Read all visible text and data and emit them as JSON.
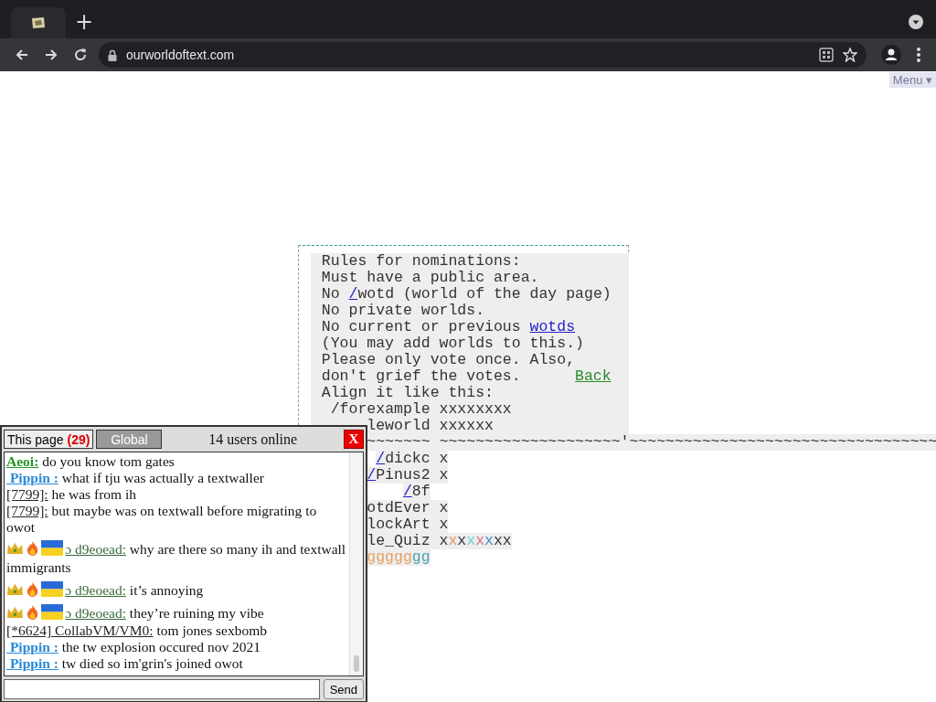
{
  "browser": {
    "new_tab": "+",
    "url": "ourworldoftext.com"
  },
  "menu": {
    "label": "Menu",
    "caret": "▾"
  },
  "world": {
    "lines": [
      [
        {
          "text": "  Rules for nominations:"
        }
      ],
      [
        {
          "text": "  Must have a public area."
        }
      ],
      [
        {
          "text": "  No "
        },
        {
          "text": "/",
          "kind": "link",
          "color": "#2020cc"
        },
        {
          "text": "wotd (world of the day page)"
        }
      ],
      [
        {
          "text": "  No private worlds."
        }
      ],
      [
        {
          "text": "  No current or previous "
        },
        {
          "text": "wotds",
          "kind": "link",
          "color": "#2020cc"
        }
      ],
      [
        {
          "text": "  (You may add worlds to this.)"
        }
      ],
      [
        {
          "text": "  Please only vote once. Also,"
        }
      ],
      [
        {
          "text": "  don't grief the votes.      "
        },
        {
          "text": "Back",
          "kind": "link",
          "color": "#2a8a2a"
        }
      ],
      [
        {
          "text": "  Align it like this:"
        }
      ],
      [
        {
          "text": "   /forexample xxxxxxxx"
        }
      ],
      [
        {
          "text": "       leworld xxxxxx"
        }
      ],
      [
        {
          "text": "       ~~~~~~~ ~~~~~~~~~~~~~~~~~~~~'~~~~~~~~~~~~~~~~~~~~~~~~~~~~~~~~~~"
        }
      ],
      [
        {
          "text": "        /",
          "kind": "link",
          "color": "#2020cc"
        },
        {
          "text": "dickc x"
        }
      ],
      [
        {
          "text": "       /",
          "kind": "link",
          "color": "#2020cc"
        },
        {
          "text": "Pinus2 x"
        }
      ],
      [
        {
          "text": "           /",
          "kind": "link",
          "color": "#2020cc"
        },
        {
          "text": "8f"
        }
      ],
      [
        {
          "text": "       otdEver x"
        }
      ],
      [
        {
          "text": "       lockArt x"
        }
      ],
      [
        {
          "text": "       le_Quiz x"
        },
        {
          "text": "x",
          "color": "#e8906a"
        },
        {
          "text": "x"
        },
        {
          "text": "x",
          "color": "#6ad0d0"
        },
        {
          "text": "x",
          "color": "#e06a7a"
        },
        {
          "text": "x",
          "color": "#4a8ad0"
        },
        {
          "text": "xx"
        }
      ],
      [
        {
          "text": "       ggggg",
          "color": "#e8a060"
        },
        {
          "text": "gg",
          "color": "#4aa0b0"
        }
      ]
    ]
  },
  "chat": {
    "tabs": [
      {
        "label": "This page",
        "count": "(29)",
        "selected": true
      },
      {
        "label": "Global",
        "selected": false
      }
    ],
    "online": "14 users online",
    "close": "X",
    "messages": [
      {
        "kind": "registered",
        "name": "Aeoi:",
        "color": "#2a962a",
        "text": "do you know tom gates"
      },
      {
        "kind": "registered",
        "name": " Pippin :",
        "color": "#2a8ad8",
        "text": "what if tju was actually a textwaller"
      },
      {
        "kind": "anon",
        "name": "[7799]:",
        "color": "#222222",
        "text": "he was from ih"
      },
      {
        "kind": "anon",
        "name": "[7799]:",
        "color": "#222222",
        "text": "but maybe was on textwall before migrating to owot"
      },
      {
        "kind": "emoji",
        "name": "ɔ d9eoead:",
        "color": "#3a6a3a",
        "text": "why are there so many ih and textwall immigrants"
      },
      {
        "kind": "emoji",
        "name": "ɔ d9eoead:",
        "color": "#3a6a3a",
        "text": "it’s annoying"
      },
      {
        "kind": "emoji",
        "name": "ɔ d9eoead:",
        "color": "#3a6a3a",
        "text": "they’re ruining my vibe"
      },
      {
        "kind": "anon",
        "name": "[*6624] CollabVM/VM0:",
        "color": "#222222",
        "text": "tom jones sexbomb"
      },
      {
        "kind": "registered",
        "name": " Pippin :",
        "color": "#2a8ad8",
        "text": "the tw explosion occured nov 2021"
      },
      {
        "kind": "registered",
        "name": " Pippin :",
        "color": "#2a8ad8",
        "text": "tw died so im'grin's joined owot"
      }
    ],
    "send": "Send"
  }
}
